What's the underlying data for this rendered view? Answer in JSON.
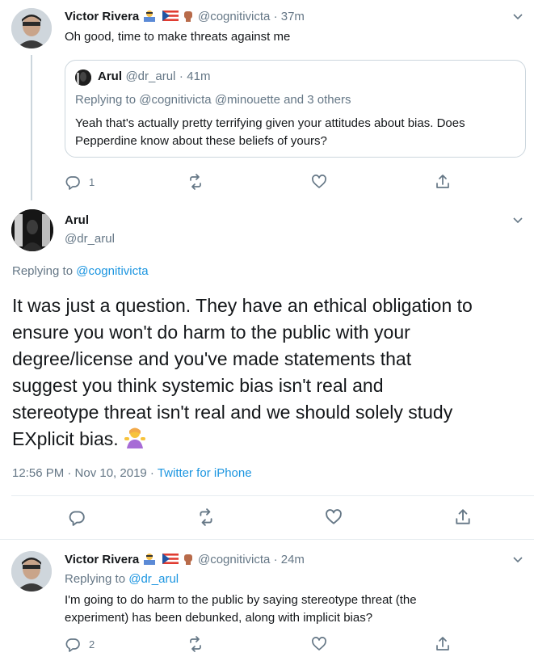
{
  "tweet1": {
    "name": "Victor Rivera",
    "handle": "@cognitivicta",
    "time": "37m",
    "text": "Oh good, time to make threats against me",
    "quote": {
      "name": "Arul",
      "handle": "@dr_arul",
      "time": "41m",
      "replying_prefix": "Replying to",
      "replying_to": "@cognitivicta @minouette and 3 others",
      "text_line1": "Yeah that's actually pretty terrifying given your attitudes about bias. Does",
      "text_line2": "Pepperdine know about these beliefs of yours?"
    },
    "reply_count": "1"
  },
  "main": {
    "name": "Arul",
    "handle": "@dr_arul",
    "replying_prefix": "Replying to",
    "replying_to": "@cognitivicta",
    "lines": [
      "It was just a question. They have an ethical obligation to",
      "ensure you won't do harm to the public with your",
      "degree/license and you've made statements that",
      "suggest you think systemic bias isn't real and",
      "stereotype threat isn't real and we should solely study",
      "EXplicit bias."
    ],
    "timestamp": "12:56 PM · Nov 10, 2019 ·",
    "source": "Twitter for iPhone"
  },
  "tweet3": {
    "name": "Victor Rivera",
    "handle": "@cognitivicta",
    "time": "24m",
    "replying_prefix": "Replying to",
    "replying_to": "@dr_arul",
    "text_line1": "I'm going to do harm to the public by saying stereotype threat (the",
    "text_line2": "experiment) has been debunked, along with implicit bias?",
    "reply_count": "2"
  },
  "colors": {
    "accent": "#1b95e0",
    "muted": "#657786",
    "border": "#e6ecf0"
  },
  "icons": [
    "reply-icon",
    "retweet-icon",
    "like-icon",
    "share-icon",
    "chevron-down-icon"
  ]
}
